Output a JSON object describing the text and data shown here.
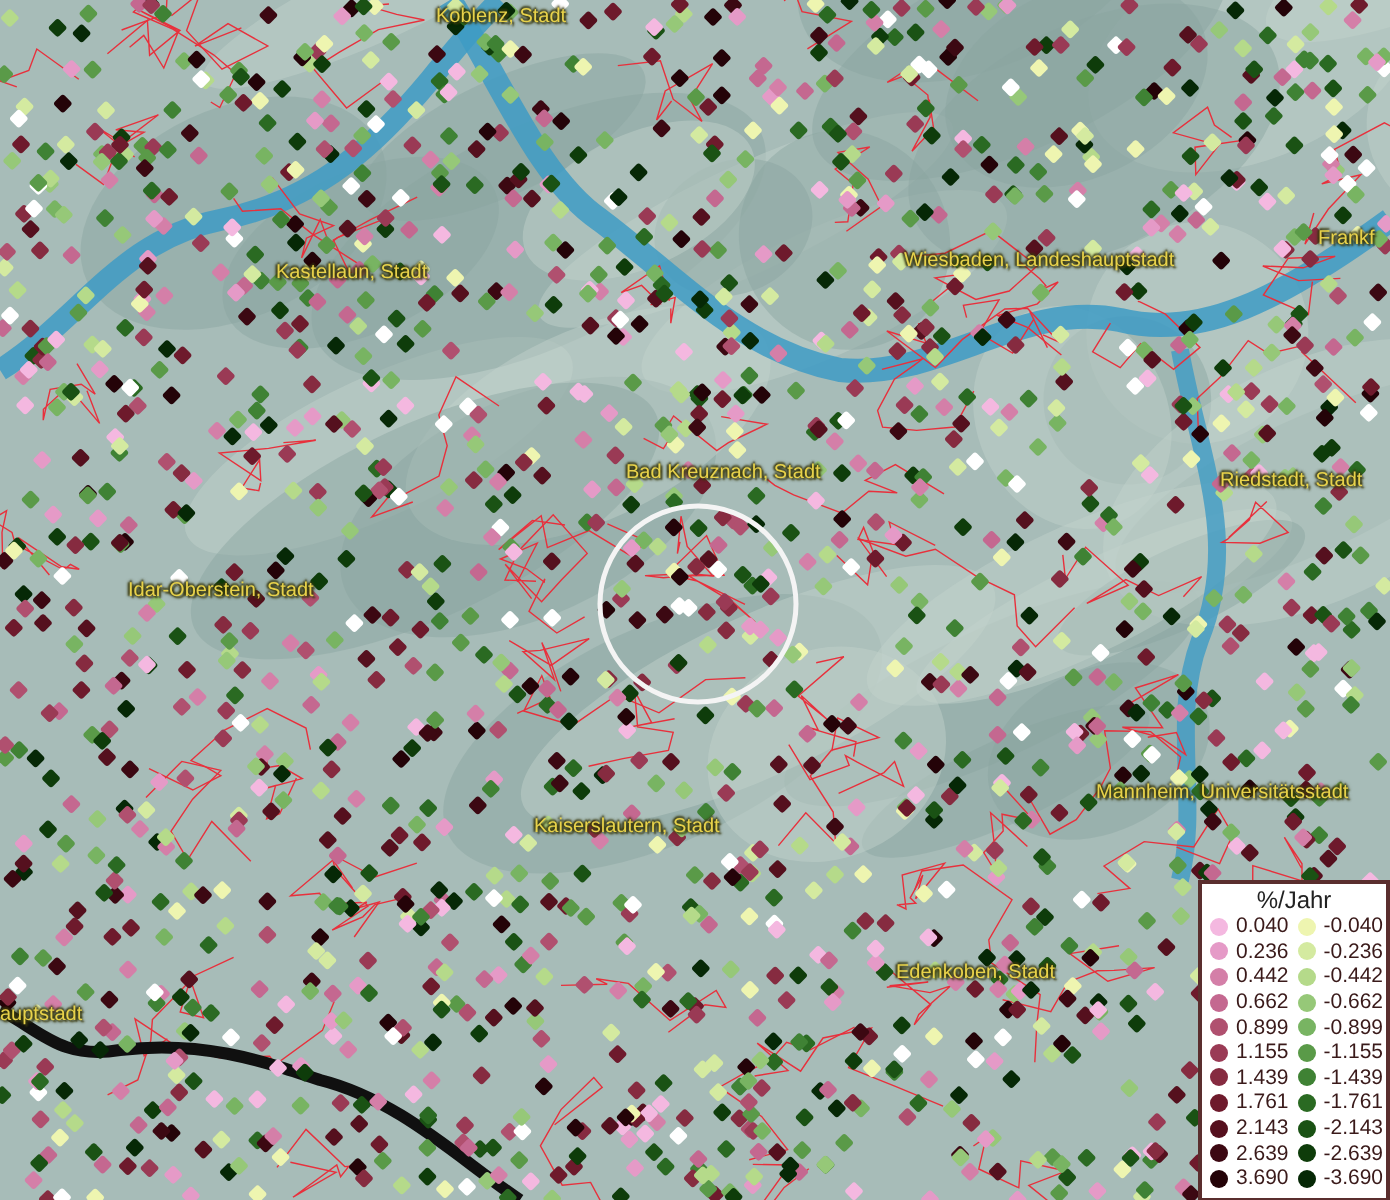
{
  "map": {
    "place_labels": [
      {
        "text": "Koblenz, Stadt"
      },
      {
        "text": "Kastellaun, Stadt"
      },
      {
        "text": "Wiesbaden, Landeshauptstadt"
      },
      {
        "text": "Frankf"
      },
      {
        "text": "Bad Kreuznach, Stadt"
      },
      {
        "text": "Riedstadt, Stadt"
      },
      {
        "text": "Idar-Oberstein, Stadt"
      },
      {
        "text": "Mannheim, Universitätsstadt"
      },
      {
        "text": "Kaiserslautern, Stadt"
      },
      {
        "text": "Edenkoben, Stadt"
      },
      {
        "text": "auptstadt"
      }
    ]
  },
  "legend": {
    "title": "%/Jahr",
    "positive": [
      {
        "value": "0.040",
        "color": "#f4b8e0"
      },
      {
        "value": "0.236",
        "color": "#e59ac7"
      },
      {
        "value": "0.442",
        "color": "#d47fa8"
      },
      {
        "value": "0.662",
        "color": "#c46890"
      },
      {
        "value": "0.899",
        "color": "#b0506f"
      },
      {
        "value": "1.155",
        "color": "#9a3a55"
      },
      {
        "value": "1.439",
        "color": "#862b40"
      },
      {
        "value": "1.761",
        "color": "#6e1a2c"
      },
      {
        "value": "2.143",
        "color": "#55101e"
      },
      {
        "value": "2.639",
        "color": "#3c0812"
      },
      {
        "value": "3.690",
        "color": "#240308"
      }
    ],
    "negative": [
      {
        "value": "-0.040",
        "color": "#eef5b0"
      },
      {
        "value": "-0.236",
        "color": "#d4eaa0"
      },
      {
        "value": "-0.442",
        "color": "#b5da8a"
      },
      {
        "value": "-0.662",
        "color": "#96c878"
      },
      {
        "value": "-0.899",
        "color": "#78b462"
      },
      {
        "value": "-1.155",
        "color": "#5a9a48"
      },
      {
        "value": "-1.439",
        "color": "#3f8234"
      },
      {
        "value": "-1.761",
        "color": "#2a6a22"
      },
      {
        "value": "-2.143",
        "color": "#1a5214"
      },
      {
        "value": "-2.639",
        "color": "#0e3c0a"
      },
      {
        "value": "-3.690",
        "color": "#062806"
      }
    ]
  }
}
